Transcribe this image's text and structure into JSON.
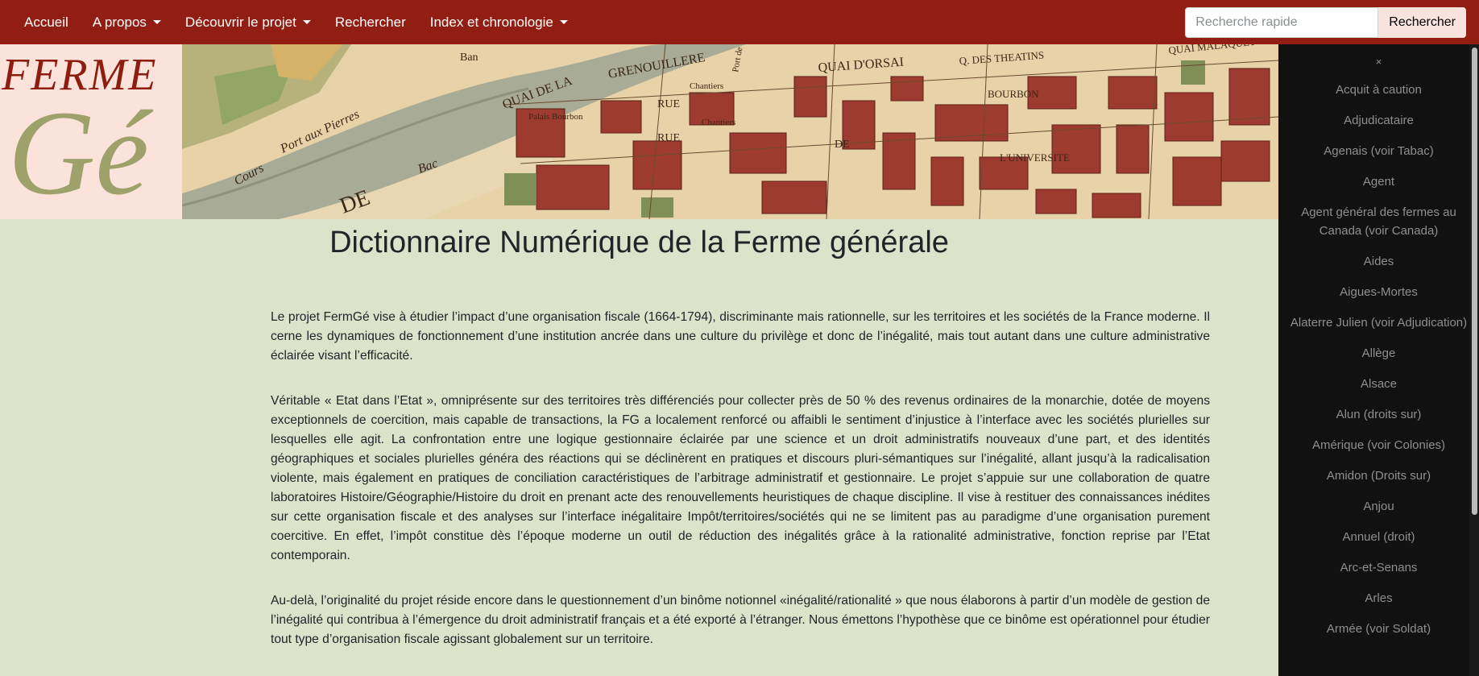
{
  "nav": {
    "items": [
      {
        "label": "Accueil",
        "dropdown": false
      },
      {
        "label": "A propos",
        "dropdown": true
      },
      {
        "label": "Découvrir le projet",
        "dropdown": true
      },
      {
        "label": "Rechercher",
        "dropdown": false
      },
      {
        "label": "Index et chronologie",
        "dropdown": true
      }
    ],
    "search_placeholder": "Recherche rapide",
    "search_button": "Rechercher"
  },
  "banner": {
    "logo_top": "FERME",
    "logo_big": "Gé",
    "map_labels": [
      "Port aux Pierres",
      "Cours",
      "DE",
      "Bac",
      "Ban",
      "QUAI DE LA",
      "GRENOUILLERE",
      "Palais Bourbon",
      "RUE",
      "RUE",
      "Chantiers",
      "Chantiers",
      "QUAI D'ORSAI",
      "Q. DES THEATINS",
      "QUAI MALAQUET",
      "BOURBON",
      "DE",
      "L'UNIVERSITE",
      "Port de"
    ]
  },
  "main": {
    "title": "Dictionnaire Numérique de la Ferme générale",
    "paragraphs": [
      "Le projet FermGé vise à étudier l’impact d’une organisation fiscale (1664-1794), discriminante mais rationnelle, sur les territoires et les sociétés de la France moderne. Il cerne les dynamiques de fonctionnement d’une institution ancrée dans une culture du privilège et donc de l’inégalité, mais tout autant dans une culture administrative éclairée visant l’efficacité.",
      "Véritable « Etat dans l’Etat », omniprésente sur des territoires très différenciés pour collecter près de 50 % des revenus ordinaires de la monarchie, dotée de moyens exceptionnels de coercition, mais capable de transactions, la FG a localement renforcé ou affaibli le sentiment d’injustice à l’interface avec les sociétés plurielles sur lesquelles elle agit. La confrontation entre une logique gestionnaire éclairée par une science et un droit administratifs nouveaux d’une part, et des identités géographiques et sociales plurielles généra des réactions qui se déclinèrent en pratiques et discours pluri-sémantiques sur l’inégalité, allant jusqu’à la radicalisation violente, mais également en pratiques de conciliation caractéristiques de l’arbitrage administratif et gestionnaire. Le projet s’appuie sur une collaboration de quatre laboratoires Histoire/Géographie/Histoire du droit en prenant acte des renouvellements heuristiques de chaque discipline. Il vise à restituer des connaissances inédites sur cette organisation fiscale et des analyses sur l’interface inégalitaire Impôt/territoires/sociétés qui ne se limitent pas au paradigme d’une organisation purement coercitive. En effet, l’impôt constitue dès l’époque moderne un outil de réduction des inégalités grâce à la rationalité administrative, fonction reprise par l’Etat contemporain.",
      "Au-delà, l’originalité du projet réside encore dans le questionnement d’un binôme notionnel «inégalité/rationalité » que nous élaborons à partir d’un modèle de gestion de l’inégalité qui contribua à l’émergence du droit administratif français et a été exporté à l’étranger. Nous émettons l’hypothèse que ce binôme est opérationnel pour étudier tout type d’organisation fiscale agissant globalement sur un territoire."
    ]
  },
  "sidebar": {
    "close": "×",
    "items": [
      "Acquit à caution",
      "Adjudicataire",
      "Agenais (voir Tabac)",
      "Agent",
      "Agent général des fermes au Canada (voir Canada)",
      "Aides",
      "Aigues-Mortes",
      "Alaterre Julien (voir Adjudication)",
      "Allège",
      "Alsace",
      "Alun (droits sur)",
      "Amérique (voir Colonies)",
      "Amidon (Droits sur)",
      "Anjou",
      "Annuel (droit)",
      "Arc-et-Senans",
      "Arles",
      "Armée (voir Soldat)"
    ]
  },
  "colors": {
    "navbar": "#911d13",
    "page_bg": "#dde2cb",
    "sidebar_bg": "#111111",
    "logo_bg": "#fbe3dc",
    "logo_red": "#8e1d10",
    "logo_olive": "#9fa16a"
  }
}
